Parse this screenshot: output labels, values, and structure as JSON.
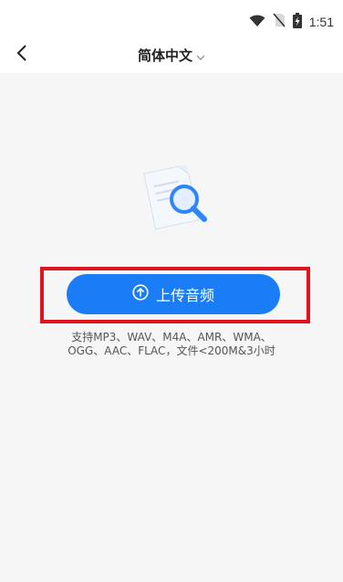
{
  "status_bar": {
    "time": "1:51"
  },
  "nav": {
    "title": "简体中文"
  },
  "upload": {
    "label": "上传音频"
  },
  "support": {
    "line1": "支持MP3、WAV、M4A、AMR、WMA、",
    "line2": "OGG、AAC、FLAC，文件<200M&3小时"
  },
  "colors": {
    "accent": "#1a7df5",
    "highlight_frame": "#e0141e",
    "background": "#f6f6f6"
  },
  "icons": [
    "wifi-icon",
    "no-sim-icon",
    "battery-icon",
    "back-arrow-icon",
    "chevron-down-icon",
    "upload-arrow-icon",
    "document-search-icon"
  ]
}
